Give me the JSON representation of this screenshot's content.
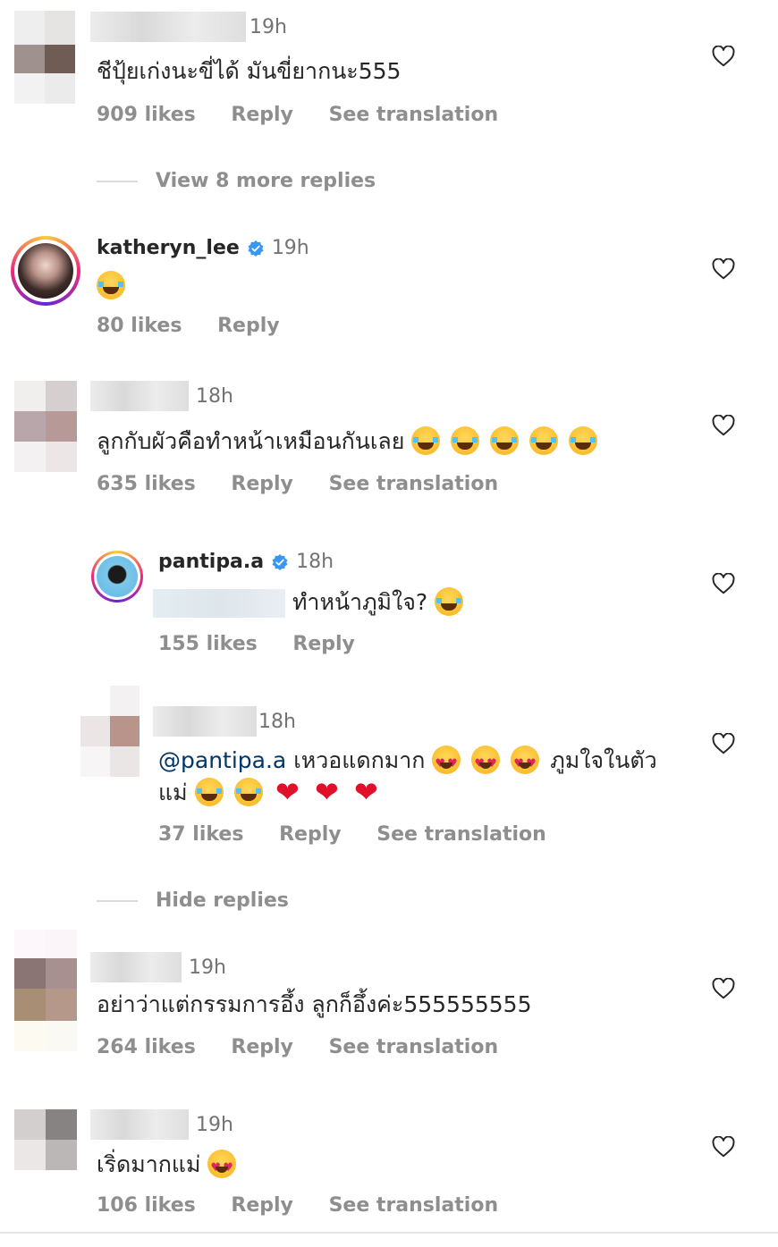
{
  "comments": [
    {
      "time": "19h",
      "text": "ชีปุ้ยเก่งนะขี่ได้ มันขี่ยากนะ555",
      "likes": "909 likes",
      "reply": "Reply",
      "translate": "See translation"
    },
    {
      "username": "katheryn_lee",
      "time": "19h",
      "likes": "80 likes",
      "reply": "Reply"
    },
    {
      "time": "18h",
      "text": "ลูกกับผัวคือทำหน้าเหมือนกันเลย",
      "likes": "635 likes",
      "reply": "Reply",
      "translate": "See translation"
    },
    {
      "username": "pantipa.a",
      "time": "18h",
      "text": "ทำหน้าภูมิใจ?",
      "likes": "155 likes",
      "reply": "Reply"
    },
    {
      "time": "18h",
      "mention": "@pantipa.a",
      "text": "เหวอแดกมาก",
      "text_b": "ภูมใจในตัว",
      "text_c": "แม่",
      "likes": "37 likes",
      "reply": "Reply",
      "translate": "See translation"
    },
    {
      "time": "19h",
      "text": "อย่าว่าแต่กรรมการอึ้ง ลูกก็อึ้งค่ะ555555555",
      "likes": "264 likes",
      "reply": "Reply",
      "translate": "See translation"
    },
    {
      "time": "19h",
      "text": "เริ่ดมากแม่",
      "likes": "106 likes",
      "reply": "Reply",
      "translate": "See translation"
    }
  ],
  "toggles": {
    "view_more": "View 8 more replies",
    "hide": "Hide replies"
  },
  "icons": {
    "heart": "heart-outline-icon",
    "verified": "verified-badge-icon"
  },
  "colors": {
    "verified": "#3897f0",
    "secondary_text": "#8e8e8e",
    "mention": "#00376b"
  }
}
